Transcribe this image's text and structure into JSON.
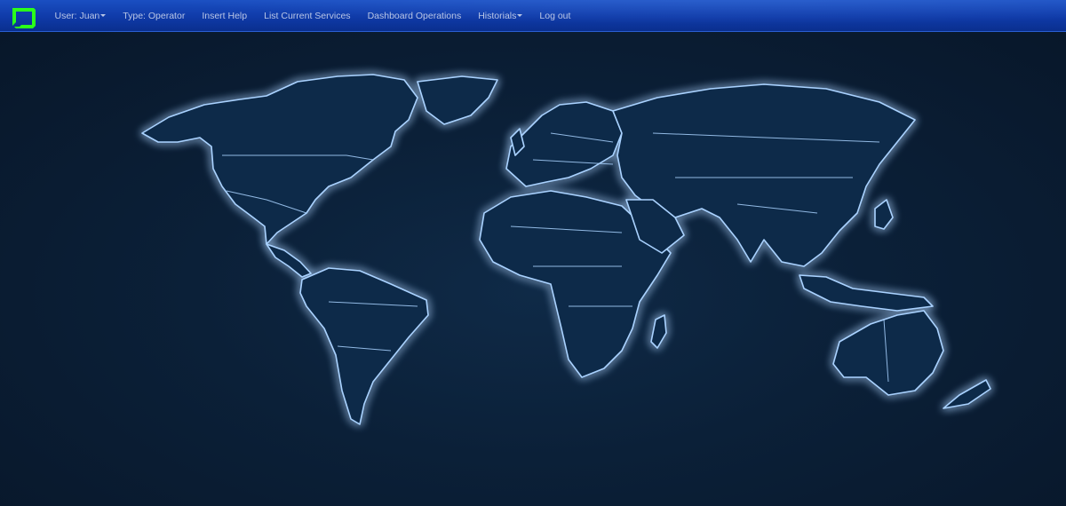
{
  "nav": {
    "logo_icon": "terminal-logo-icon",
    "logo_color": "#2bff1a",
    "user_label": "User: Juan",
    "type_label": "Type: Operator",
    "insert_help_label": "Insert Help",
    "list_services_label": "List Current Services",
    "dashboard_label": "Dashboard Operations",
    "historials_label": "Historials",
    "logout_label": "Log out"
  },
  "map": {
    "style": "world-map-glowing-borders",
    "land_color": "#102a4a",
    "border_color": "#a9d2ff",
    "glow_color": "#3f8fff"
  }
}
